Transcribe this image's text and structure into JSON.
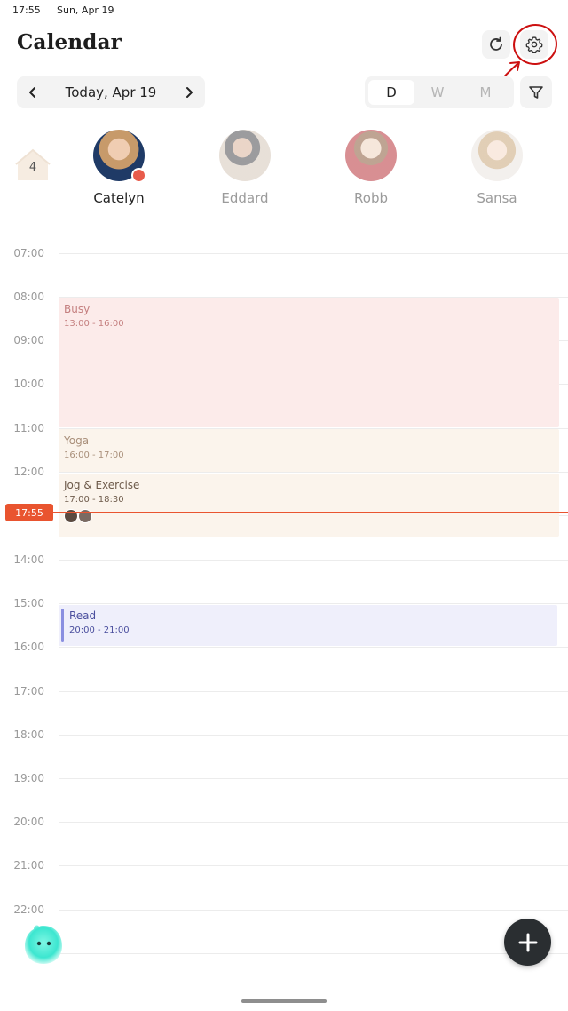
{
  "status": {
    "time": "17:55",
    "date": "Sun, Apr 19"
  },
  "header": {
    "title": "Calendar",
    "sync_icon": "refresh-icon",
    "settings_icon": "gear-icon"
  },
  "date_nav": {
    "label": "Today, Apr 19",
    "prev_icon": "chevron-left-icon",
    "next_icon": "chevron-right-icon"
  },
  "view_toggle": {
    "options": [
      "D",
      "W",
      "M"
    ],
    "selected": "D"
  },
  "filter": {
    "icon": "filter-icon"
  },
  "household": {
    "count": "4",
    "icon": "home-icon"
  },
  "members": [
    {
      "name": "Catelyn",
      "active": true,
      "color": "#e85b4b"
    },
    {
      "name": "Eddard",
      "active": false
    },
    {
      "name": "Robb",
      "active": false
    },
    {
      "name": "Sansa",
      "active": false
    }
  ],
  "timeline": {
    "hours": [
      "07:00",
      "08:00",
      "09:00",
      "10:00",
      "11:00",
      "12:00",
      "14:00",
      "15:00",
      "16:00",
      "17:00",
      "18:00",
      "19:00",
      "20:00",
      "21:00",
      "22:00",
      "2"
    ],
    "now_label": "17:55"
  },
  "events": [
    {
      "title": "Busy",
      "time": "13:00 - 16:00",
      "bg": "#fcebea",
      "color": "#c47f7f"
    },
    {
      "title": "Yoga",
      "time": "16:00 - 17:00",
      "bg": "#fbf4ec",
      "color": "#a98f7a"
    },
    {
      "title": "Jog & Exercise",
      "time": "17:00 - 18:30",
      "bg": "#fbf4ec",
      "color": "#6d5a4a"
    },
    {
      "title": "Read",
      "time": "20:00 - 21:00",
      "bg": "#efeffb",
      "color": "#4b4f9e",
      "accent": "#8a8fe0"
    }
  ],
  "colors": {
    "accent": "#e9542f",
    "annotation": "#cc1010"
  }
}
